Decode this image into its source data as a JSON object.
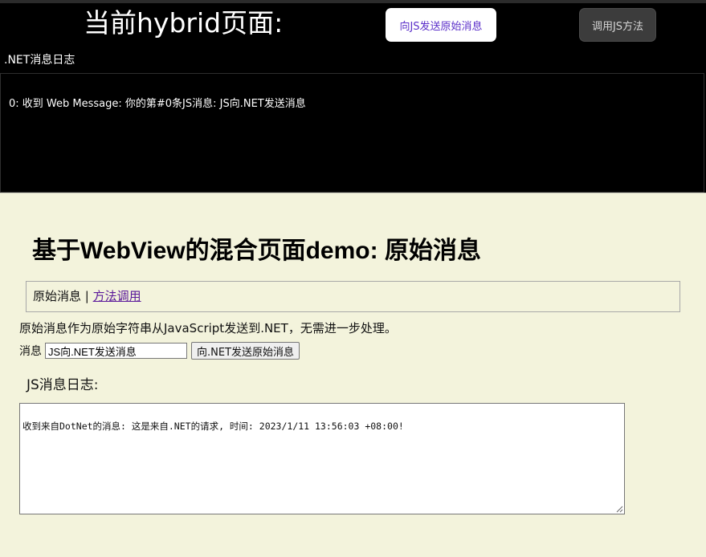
{
  "host": {
    "title": "当前hybrid页面:",
    "send_button": "向JS发送原始消息",
    "call_button": "调用JS方法",
    "net_log_label": ".NET消息日志",
    "net_log_entries": [
      "0: 收到 Web Message: 你的第#0条JS消息: JS向.NET发送消息"
    ]
  },
  "webview": {
    "heading": "基于WebView的混合页面demo: 原始消息",
    "nav": {
      "current": "原始消息",
      "separator": " | ",
      "link": "方法调用"
    },
    "description": "原始消息作为原始字符串从JavaScript发送到.NET，无需进一步处理。",
    "message_label": "消息",
    "message_value": "JS向.NET发送消息",
    "send_button": "向.NET发送原始消息",
    "js_log_label": "JS消息日志:",
    "js_log_entries": [
      "收到来自DotNet的消息: 这是来自.NET的请求, 时间: 2023/1/11 13:56:03 +08:00!"
    ]
  }
}
